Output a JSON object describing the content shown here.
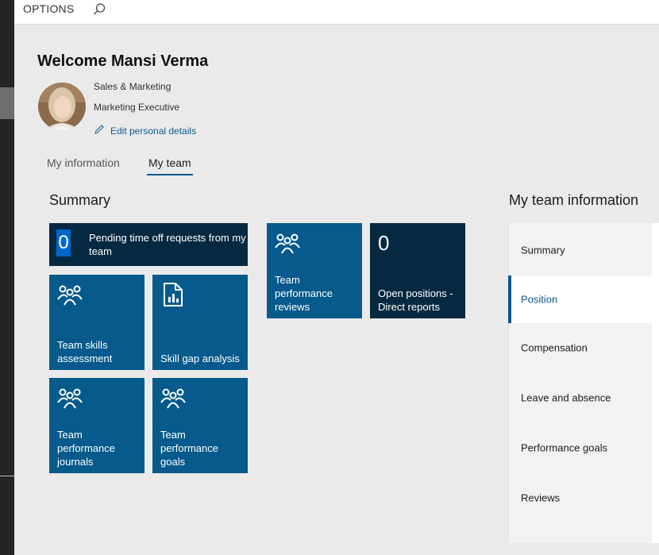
{
  "topbar": {
    "options_label": "OPTIONS",
    "search_icon": "search-icon"
  },
  "user": {
    "welcome": "Welcome Mansi Verma",
    "department": "Sales & Marketing",
    "job_title": "Marketing Executive",
    "edit_link": "Edit personal details"
  },
  "tabs": [
    {
      "label": "My information",
      "selected": false
    },
    {
      "label": "My team",
      "selected": true
    }
  ],
  "summary": {
    "title": "Summary",
    "pending": {
      "count": "0",
      "label": "Pending time off requests from my team"
    },
    "tiles": {
      "skills": "Team skills assessment",
      "skill_gap": "Skill gap analysis",
      "journals": "Team performance journals",
      "goals": "Team performance goals",
      "reviews": "Team performance reviews"
    },
    "open_positions": {
      "count": "0",
      "label": "Open positions - Direct reports"
    }
  },
  "team_info": {
    "title": "My team information",
    "items": [
      "Summary",
      "Position",
      "Compensation",
      "Leave and absence",
      "Performance goals",
      "Reviews"
    ],
    "selected": "Position"
  },
  "colors": {
    "tile_blue": "#065a8c",
    "tile_dark": "#062942",
    "accent": "#0f5b8e",
    "count_highlight": "#0066cc"
  }
}
